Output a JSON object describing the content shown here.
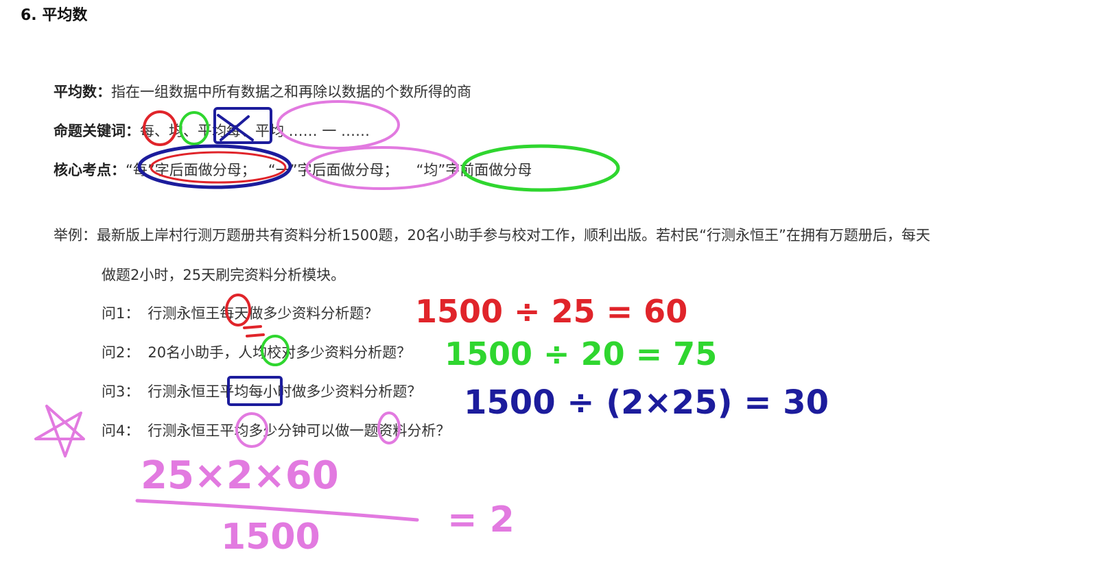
{
  "heading": "6. 平均数",
  "definition": {
    "label": "平均数：",
    "text": "指在一组数据中所有数据之和再除以数据的个数所得的商"
  },
  "keywords": {
    "label": "命题关键词：",
    "k1": "每、",
    "k2": "均、",
    "k3": "平均每、",
    "k4": "平均 …… 一 ……"
  },
  "core": {
    "label": "核心考点：",
    "c1": "“每”字后面做分母；",
    "c2": "“一”字后面做分母；",
    "c3": "“均”字前面做分母"
  },
  "example": {
    "label": "举例：",
    "line1": "最新版上岸村行测万题册共有资料分析1500题，20名小助手参与校对工作，顺利出版。若村民“行测永恒王”在拥有万题册后，每天",
    "line2": "做题2小时，25天刷完资料分析模块。"
  },
  "questions": [
    {
      "label": "问1：",
      "text": "行测永恒王每天做多少资料分析题？",
      "answer": "1500 ÷ 25 = 60"
    },
    {
      "label": "问2：",
      "text": "20名小助手，人均校对多少资料分析题？",
      "answer": "1500 ÷ 20 = 75"
    },
    {
      "label": "问3：",
      "text": "行测永恒王平均每小时做多少资料分析题？",
      "answer": "1500 ÷ (2×25) = 30"
    },
    {
      "label": "问4：",
      "text": "行测永恒王平均多少分钟可以做一题资料分析？"
    }
  ],
  "q4_work": {
    "numerator": "25×2×60",
    "denominator": "1500",
    "result": "= 2"
  },
  "colors": {
    "red": "#e0242a",
    "green": "#2fd62f",
    "blue": "#1c1c9c",
    "pink": "#e27ae0"
  }
}
